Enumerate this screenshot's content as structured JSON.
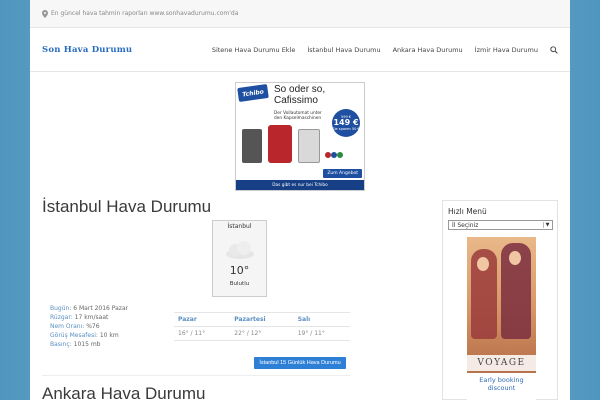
{
  "topbar": {
    "text": "En güncel hava tahmin raporları www.sonhavadurumu.com'da"
  },
  "header": {
    "logo": "Son Hava Durumu",
    "nav": [
      "Sitene Hava Durumu Ekle",
      "İstanbul Hava Durumu",
      "Ankara Hava Durumu",
      "İzmir Hava Durumu"
    ]
  },
  "ad_top": {
    "brand": "Tchibo",
    "headline_1": "So oder so,",
    "headline_2": "Cafissimo",
    "subline": "Der Vollautomat unter den Kapselmaschinen",
    "price_old": "599 €",
    "price": "149 €",
    "price_note": "Sie sparen 50 €",
    "cta": "Zum Angebot",
    "footer": "Das gibt es nur bei Tchibo"
  },
  "sections": [
    {
      "title": "İstanbul Hava Durumu"
    },
    {
      "title": "Ankara Hava Durumu"
    }
  ],
  "istanbul": {
    "card": {
      "city": "İstanbul",
      "temp": "10°",
      "condition": "Bulutlu",
      "icon": "cloud-icon"
    },
    "details": [
      {
        "label": "Bugün:",
        "value": "6 Mart 2016 Pazar"
      },
      {
        "label": "Rüzgar:",
        "value": "17 km/saat"
      },
      {
        "label": "Nem Oranı:",
        "value": "%76"
      },
      {
        "label": "Görüş Mesafesi:",
        "value": "10 km"
      },
      {
        "label": "Basınç:",
        "value": "1015 mb"
      }
    ],
    "forecast": {
      "days": [
        "Pazar",
        "Pazartesi",
        "Salı"
      ],
      "temps": [
        "16° / 11°",
        "22° / 12°",
        "19° / 11°"
      ]
    },
    "button": "İstanbul 15 Günlük Hava Durumu"
  },
  "sidebar": {
    "widget_title": "Hızlı Menü",
    "select_value": "İl Seçiniz",
    "ad": {
      "brand": "VOYAGE",
      "cta_1": "Early booking",
      "cta_2": "discount"
    }
  }
}
